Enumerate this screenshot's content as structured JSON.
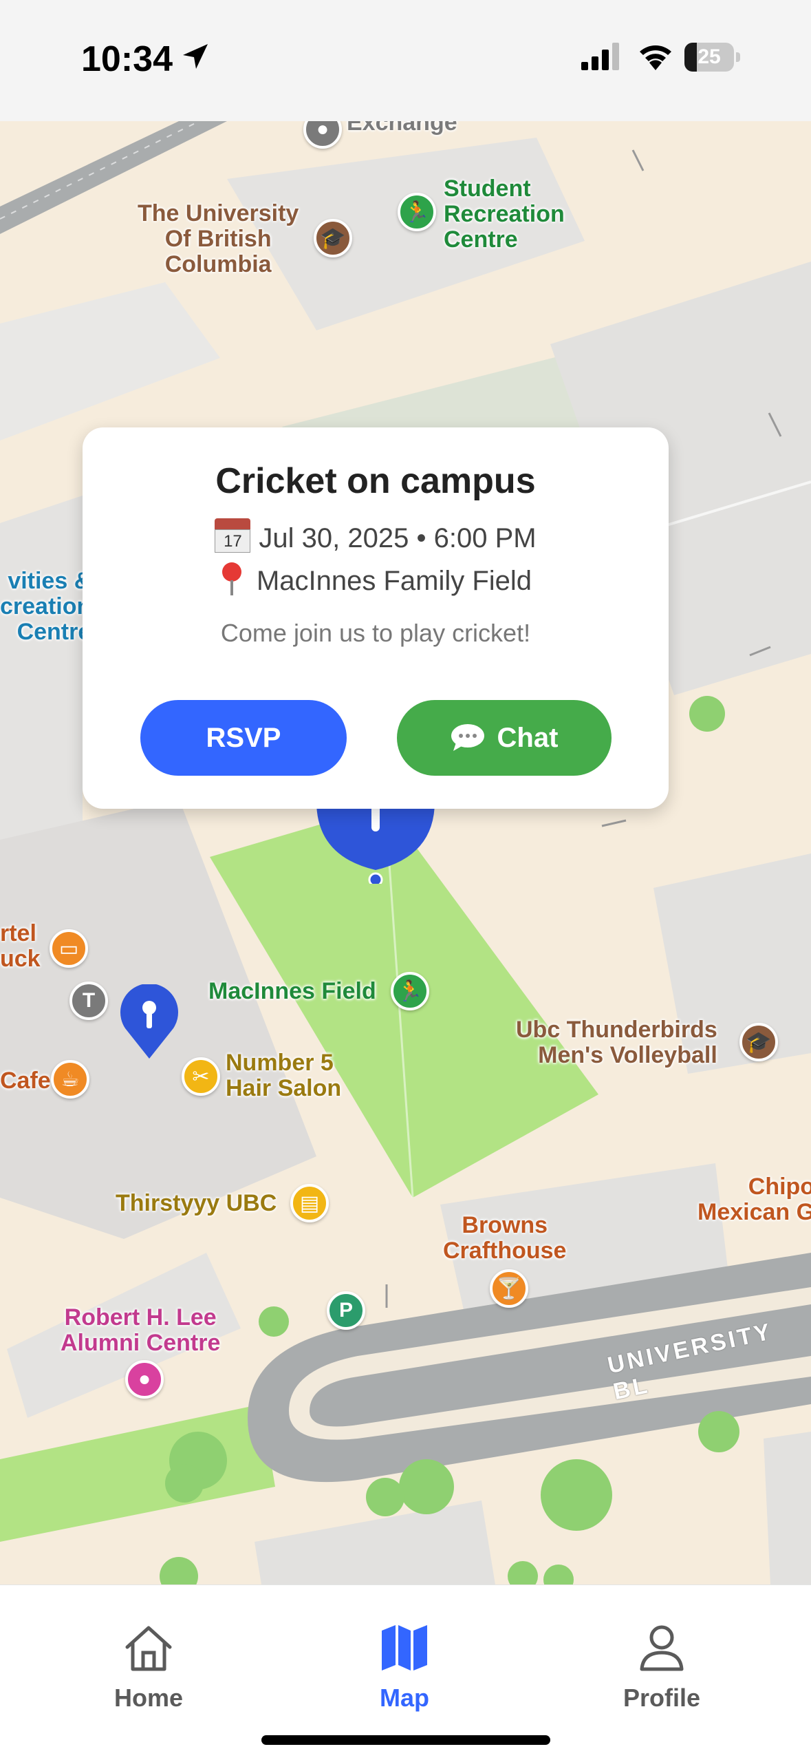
{
  "status": {
    "time": "10:34",
    "battery": "25",
    "battery_level": 0.25
  },
  "map": {
    "pois": [
      {
        "id": "exchange",
        "label": "Exchange",
        "color": "#7a7a7a"
      },
      {
        "id": "ubc",
        "label": "The University\nOf British\nColumbia",
        "color": "#8a5a3c"
      },
      {
        "id": "src",
        "label": "Student\nRecreation\nCentre",
        "color": "#1f8a3a"
      },
      {
        "id": "activities",
        "label": "vities &\ncreation\nCentre",
        "color": "#1a7fb3"
      },
      {
        "id": "cartel",
        "label": "rtel\nuck",
        "color": "#c0561f"
      },
      {
        "id": "cafe",
        "label": "Cafe",
        "color": "#c0561f"
      },
      {
        "id": "macinnes",
        "label": "MacInnes Field",
        "color": "#1f8a3a"
      },
      {
        "id": "salon",
        "label": "Number 5\nHair Salon",
        "color": "#9a7a10"
      },
      {
        "id": "thunderbirds",
        "label": "Ubc Thunderbirds\nMen's Volleyball",
        "color": "#8a5a3c"
      },
      {
        "id": "thirstyyy",
        "label": "Thirstyyy UBC",
        "color": "#9a7a10"
      },
      {
        "id": "browns",
        "label": "Browns\nCrafthouse",
        "color": "#c0561f"
      },
      {
        "id": "chipotle",
        "label": "Chipo\nMexican G",
        "color": "#c0561f"
      },
      {
        "id": "lee",
        "label": "Robert H. Lee\nAlumni Centre",
        "color": "#c23a8e"
      }
    ],
    "road_label": "UNIVERSITY BL"
  },
  "event": {
    "title": "Cricket on campus",
    "date_icon": "calendar-icon",
    "datetime": "Jul 30, 2025 • 6:00 PM",
    "location_icon": "pin-icon",
    "location": "MacInnes Family Field",
    "description": "Come join us to play cricket!",
    "rsvp_label": "RSVP",
    "chat_label": "Chat"
  },
  "tabs": [
    {
      "label": "Home",
      "icon": "house-icon",
      "active": false
    },
    {
      "label": "Map",
      "icon": "map-icon",
      "active": true
    },
    {
      "label": "Profile",
      "icon": "person-icon",
      "active": false
    }
  ],
  "colors": {
    "accent": "#3366ff",
    "chat": "#45ab4a",
    "tab_active": "#3366ff",
    "tab_inactive": "#5a5a5a"
  }
}
